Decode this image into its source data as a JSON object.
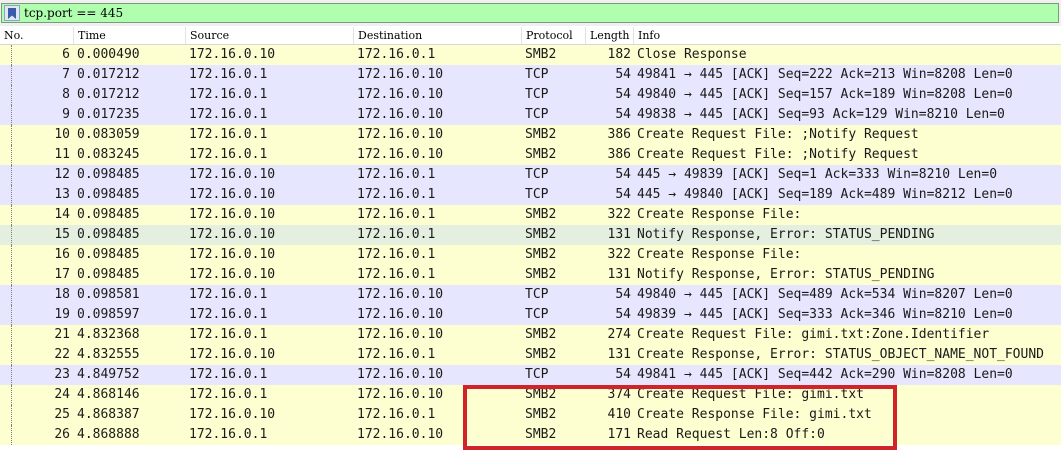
{
  "filter": {
    "text": "tcp.port == 445",
    "background": "#afffaf"
  },
  "icons": {
    "bookmark": "bookmark-icon"
  },
  "columns": {
    "no": "No.",
    "time": "Time",
    "source": "Source",
    "destination": "Destination",
    "protocol": "Protocol",
    "length": "Length",
    "info": "Info"
  },
  "colors": {
    "smb_row": "#feffd0",
    "tcp_row": "#e7e6ff",
    "pending_row": "#e4efe0",
    "highlight_box": "#d0232a"
  },
  "packets": [
    {
      "no": "6",
      "time": "0.000490",
      "source": "172.16.0.10",
      "destination": "172.16.0.1",
      "protocol": "SMB2",
      "length": "182",
      "info": "Close Response",
      "row_color": "#feffd0"
    },
    {
      "no": "7",
      "time": "0.017212",
      "source": "172.16.0.1",
      "destination": "172.16.0.10",
      "protocol": "TCP",
      "length": "54",
      "info": "49841 → 445 [ACK] Seq=222 Ack=213 Win=8208 Len=0",
      "row_color": "#e7e6ff"
    },
    {
      "no": "8",
      "time": "0.017212",
      "source": "172.16.0.1",
      "destination": "172.16.0.10",
      "protocol": "TCP",
      "length": "54",
      "info": "49840 → 445 [ACK] Seq=157 Ack=189 Win=8208 Len=0",
      "row_color": "#e7e6ff"
    },
    {
      "no": "9",
      "time": "0.017235",
      "source": "172.16.0.1",
      "destination": "172.16.0.10",
      "protocol": "TCP",
      "length": "54",
      "info": "49838 → 445 [ACK] Seq=93 Ack=129 Win=8210 Len=0",
      "row_color": "#e7e6ff"
    },
    {
      "no": "10",
      "time": "0.083059",
      "source": "172.16.0.1",
      "destination": "172.16.0.10",
      "protocol": "SMB2",
      "length": "386",
      "info": "Create Request File: ;Notify Request",
      "row_color": "#feffd0"
    },
    {
      "no": "11",
      "time": "0.083245",
      "source": "172.16.0.1",
      "destination": "172.16.0.10",
      "protocol": "SMB2",
      "length": "386",
      "info": "Create Request File: ;Notify Request",
      "row_color": "#feffd0"
    },
    {
      "no": "12",
      "time": "0.098485",
      "source": "172.16.0.10",
      "destination": "172.16.0.1",
      "protocol": "TCP",
      "length": "54",
      "info": "445 → 49839 [ACK] Seq=1 Ack=333 Win=8210 Len=0",
      "row_color": "#e7e6ff"
    },
    {
      "no": "13",
      "time": "0.098485",
      "source": "172.16.0.10",
      "destination": "172.16.0.1",
      "protocol": "TCP",
      "length": "54",
      "info": "445 → 49840 [ACK] Seq=189 Ack=489 Win=8212 Len=0",
      "row_color": "#e7e6ff"
    },
    {
      "no": "14",
      "time": "0.098485",
      "source": "172.16.0.10",
      "destination": "172.16.0.1",
      "protocol": "SMB2",
      "length": "322",
      "info": "Create Response File:",
      "row_color": "#feffd0"
    },
    {
      "no": "15",
      "time": "0.098485",
      "source": "172.16.0.10",
      "destination": "172.16.0.1",
      "protocol": "SMB2",
      "length": "131",
      "info": "Notify Response, Error: STATUS_PENDING",
      "row_color": "#e4efe0"
    },
    {
      "no": "16",
      "time": "0.098485",
      "source": "172.16.0.10",
      "destination": "172.16.0.1",
      "protocol": "SMB2",
      "length": "322",
      "info": "Create Response File:",
      "row_color": "#feffd0"
    },
    {
      "no": "17",
      "time": "0.098485",
      "source": "172.16.0.10",
      "destination": "172.16.0.1",
      "protocol": "SMB2",
      "length": "131",
      "info": "Notify Response, Error: STATUS_PENDING",
      "row_color": "#feffd0"
    },
    {
      "no": "18",
      "time": "0.098581",
      "source": "172.16.0.1",
      "destination": "172.16.0.10",
      "protocol": "TCP",
      "length": "54",
      "info": "49840 → 445 [ACK] Seq=489 Ack=534 Win=8207 Len=0",
      "row_color": "#e7e6ff"
    },
    {
      "no": "19",
      "time": "0.098597",
      "source": "172.16.0.1",
      "destination": "172.16.0.10",
      "protocol": "TCP",
      "length": "54",
      "info": "49839 → 445 [ACK] Seq=333 Ack=346 Win=8210 Len=0",
      "row_color": "#e7e6ff"
    },
    {
      "no": "21",
      "time": "4.832368",
      "source": "172.16.0.1",
      "destination": "172.16.0.10",
      "protocol": "SMB2",
      "length": "274",
      "info": "Create Request File: gimi.txt:Zone.Identifier",
      "row_color": "#feffd0"
    },
    {
      "no": "22",
      "time": "4.832555",
      "source": "172.16.0.10",
      "destination": "172.16.0.1",
      "protocol": "SMB2",
      "length": "131",
      "info": "Create Response, Error: STATUS_OBJECT_NAME_NOT_FOUND",
      "row_color": "#feffd0"
    },
    {
      "no": "23",
      "time": "4.849752",
      "source": "172.16.0.1",
      "destination": "172.16.0.10",
      "protocol": "TCP",
      "length": "54",
      "info": "49841 → 445 [ACK] Seq=442 Ack=290 Win=8208 Len=0",
      "row_color": "#e7e6ff"
    },
    {
      "no": "24",
      "time": "4.868146",
      "source": "172.16.0.1",
      "destination": "172.16.0.10",
      "protocol": "SMB2",
      "length": "374",
      "info": "Create Request File: gimi.txt",
      "row_color": "#feffd0"
    },
    {
      "no": "25",
      "time": "4.868387",
      "source": "172.16.0.10",
      "destination": "172.16.0.1",
      "protocol": "SMB2",
      "length": "410",
      "info": "Create Response File: gimi.txt",
      "row_color": "#feffd0"
    },
    {
      "no": "26",
      "time": "4.868888",
      "source": "172.16.0.1",
      "destination": "172.16.0.10",
      "protocol": "SMB2",
      "length": "171",
      "info": "Read Request Len:8 Off:0",
      "row_color": "#feffd0"
    }
  ]
}
